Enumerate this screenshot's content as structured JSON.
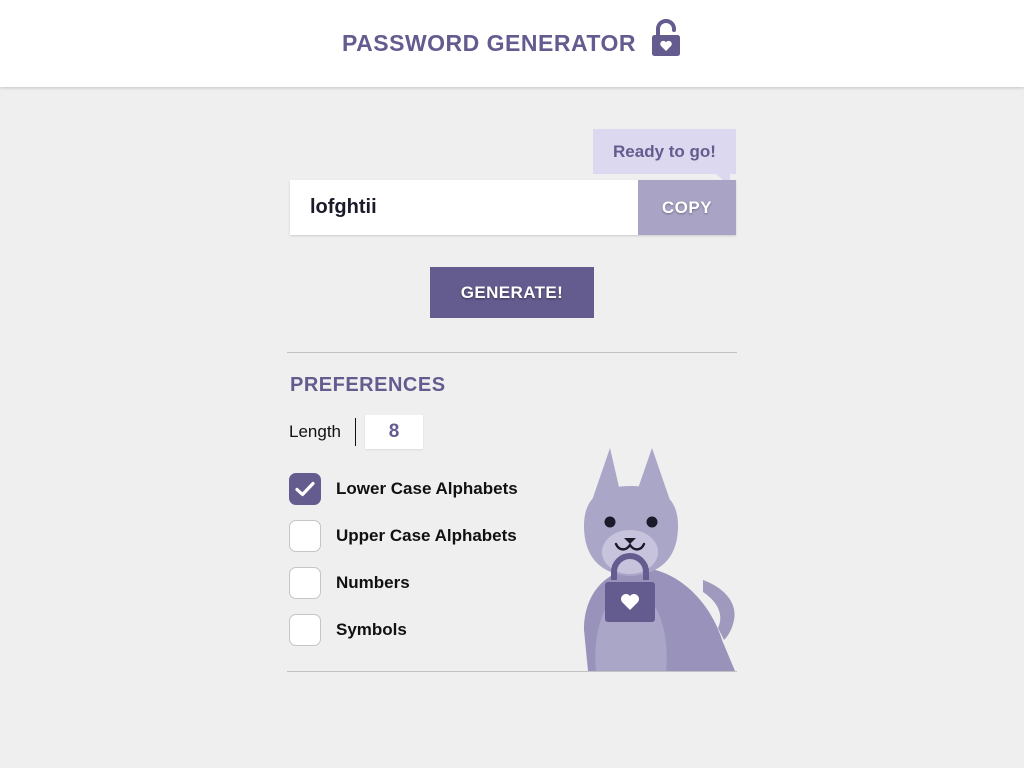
{
  "header": {
    "title": "PASSWORD GENERATOR",
    "logo_icon": "lock-heart-icon"
  },
  "status": {
    "tooltip": "Ready to go!"
  },
  "password": {
    "value": "lofghtii",
    "copy_label": "COPY"
  },
  "generate": {
    "label": "GENERATE!"
  },
  "preferences": {
    "title": "PREFERENCES",
    "length_label": "Length",
    "length_value": "8",
    "options": [
      {
        "label": "Lower Case Alphabets",
        "checked": true
      },
      {
        "label": "Upper Case Alphabets",
        "checked": false
      },
      {
        "label": "Numbers",
        "checked": false
      },
      {
        "label": "Symbols",
        "checked": false
      }
    ]
  },
  "illustration": {
    "icon": "dog-with-lock-icon"
  },
  "colors": {
    "accent": "#645c8f",
    "accent_light": "#a9a4c6",
    "tooltip_bg": "#dcd8ef",
    "background": "#efefef"
  }
}
